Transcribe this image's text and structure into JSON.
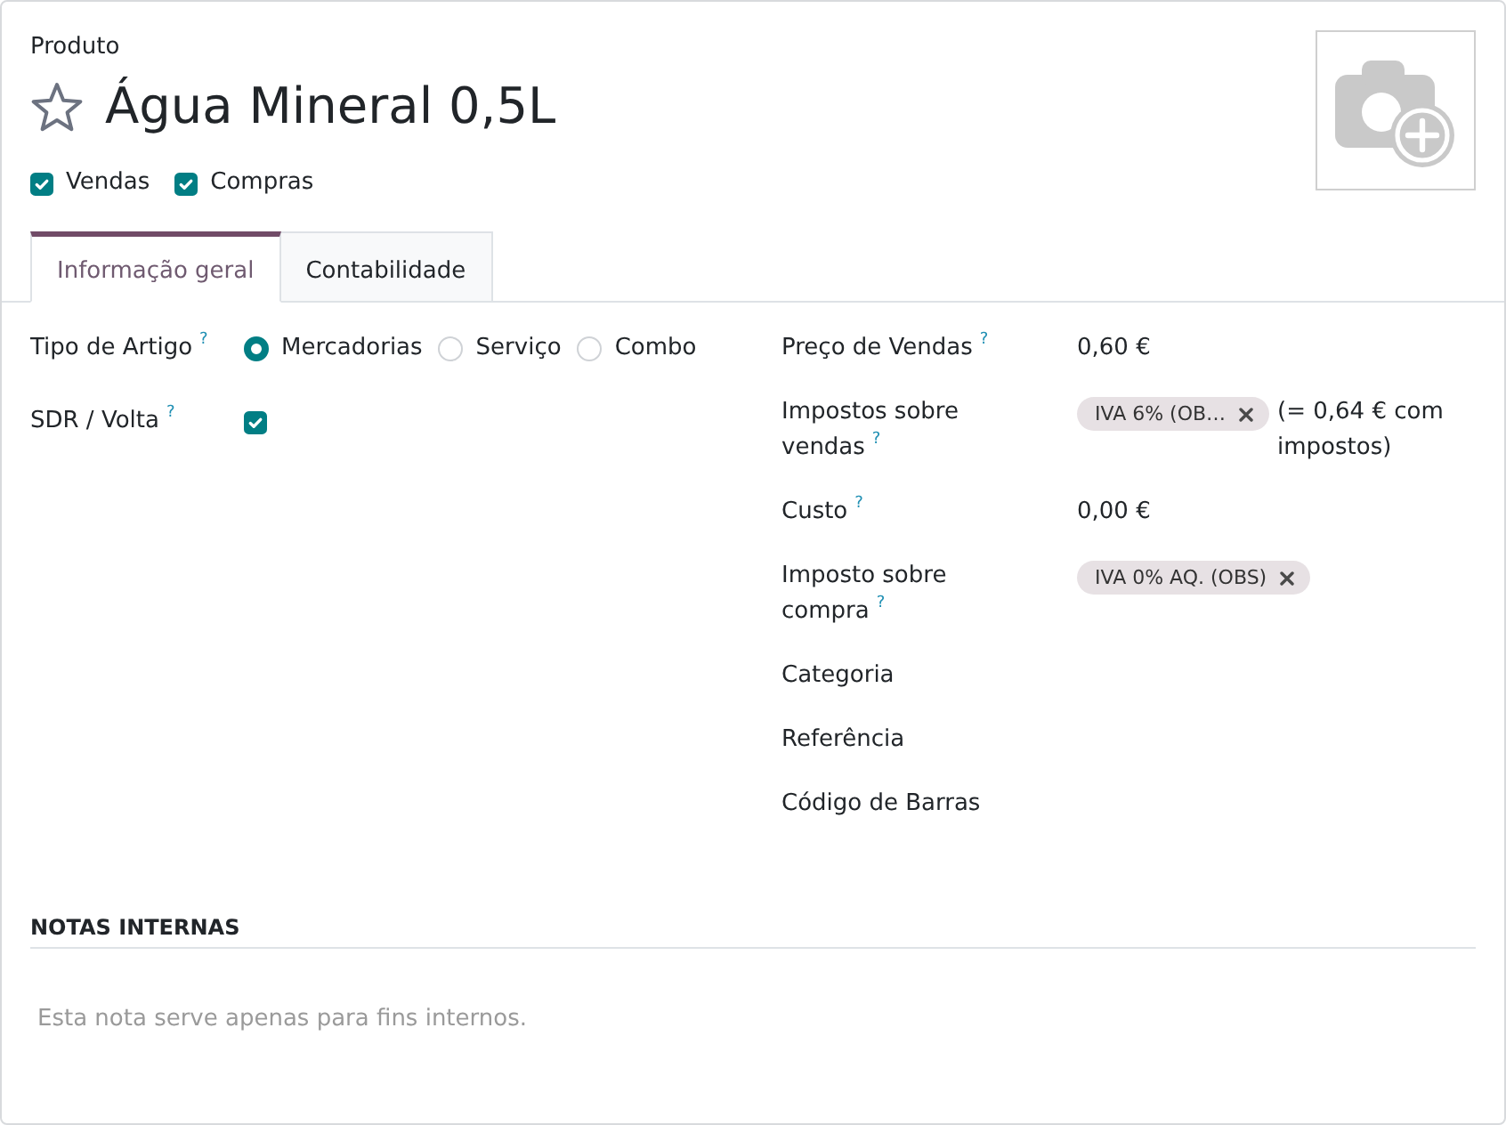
{
  "header": {
    "label": "Produto",
    "name": "Água Mineral 0,5L",
    "favorite": false
  },
  "flags": [
    {
      "label": "Vendas",
      "checked": true
    },
    {
      "label": "Compras",
      "checked": true
    }
  ],
  "tabs": [
    {
      "label": "Informação geral",
      "selected": true
    },
    {
      "label": "Contabilidade",
      "selected": false
    }
  ],
  "left_fields": [
    {
      "kind": "radio",
      "label": "Tipo de Artigo",
      "help": "?",
      "options": [
        {
          "label": "Mercadorias",
          "selected": true
        },
        {
          "label": "Serviço",
          "selected": false
        },
        {
          "label": "Combo",
          "selected": false
        }
      ]
    },
    {
      "kind": "checkbox",
      "label": "SDR / Volta",
      "help": "?",
      "checked": true
    }
  ],
  "right_fields": [
    {
      "kind": "text",
      "label": "Preço de Vendas",
      "help": "?",
      "value": "0,60 €"
    },
    {
      "kind": "tags",
      "label": "Impostos sobre vendas",
      "help": "?",
      "tags": [
        "IVA 6% (OB…"
      ],
      "note": "(= 0,64 € com impostos)"
    },
    {
      "kind": "text",
      "label": "Custo",
      "help": "?",
      "value": "0,00 €"
    },
    {
      "kind": "tags",
      "label": "Imposto sobre compra",
      "help": "?",
      "tags": [
        "IVA 0% AQ. (OBS)"
      ]
    },
    {
      "kind": "text",
      "label": "Categoria"
    },
    {
      "kind": "text",
      "label": "Referência"
    },
    {
      "kind": "text",
      "label": "Código de Barras"
    }
  ],
  "internal_notes": {
    "title": "NOTAS INTERNAS",
    "placeholder": "Esta nota serve apenas para fins internos."
  }
}
